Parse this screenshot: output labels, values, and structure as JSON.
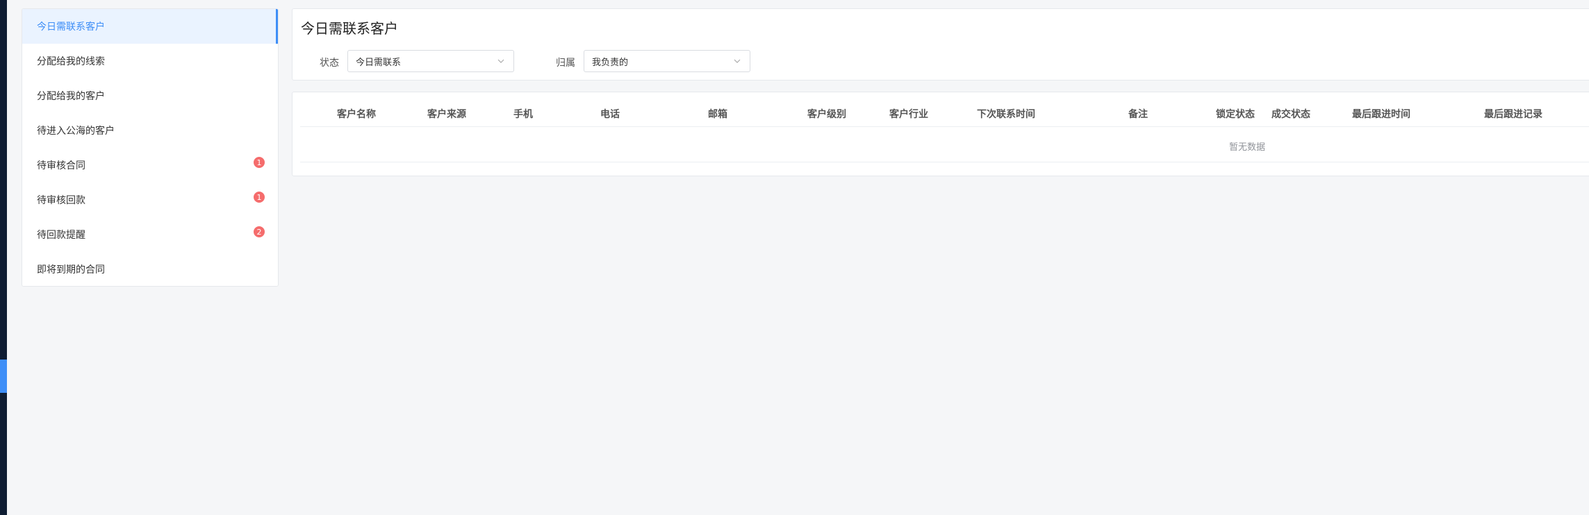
{
  "sidebar": {
    "items": [
      {
        "label": "今日需联系客户",
        "active": true
      },
      {
        "label": "分配给我的线索"
      },
      {
        "label": "分配给我的客户"
      },
      {
        "label": "待进入公海的客户"
      },
      {
        "label": "待审核合同",
        "badge": "1"
      },
      {
        "label": "待审核回款",
        "badge": "1"
      },
      {
        "label": "待回款提醒",
        "badge": "2"
      },
      {
        "label": "即将到期的合同"
      }
    ]
  },
  "filters": {
    "title": "今日需联系客户",
    "status_label": "状态",
    "status_value": "今日需联系",
    "owner_label": "归属",
    "owner_value": "我负责的"
  },
  "table": {
    "columns": [
      "客户名称",
      "客户来源",
      "手机",
      "电话",
      "邮箱",
      "客户级别",
      "客户行业",
      "下次联系时间",
      "备注",
      "锁定状态",
      "成交状态",
      "最后跟进时间",
      "最后跟进记录"
    ],
    "empty_text": "暂无数据"
  },
  "colors": {
    "accent": "#3e8ef7",
    "badge": "#f56c6c",
    "rail": "#0f1d33"
  }
}
